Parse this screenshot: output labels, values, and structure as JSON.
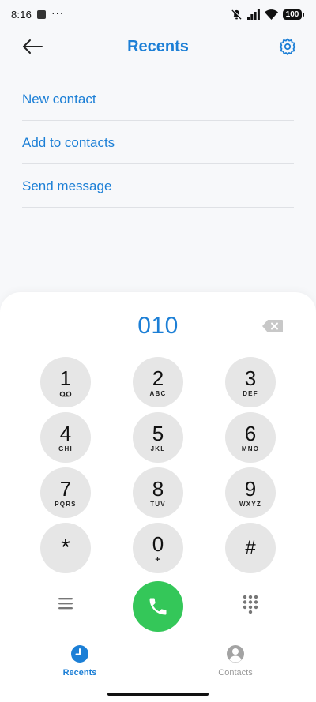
{
  "status_bar": {
    "time": "8:16",
    "dots": "···",
    "battery": "100"
  },
  "header": {
    "title": "Recents",
    "back_icon": "arrow-left-icon",
    "settings_icon": "gear-icon"
  },
  "actions": [
    {
      "label": "New contact"
    },
    {
      "label": "Add to contacts"
    },
    {
      "label": "Send message"
    }
  ],
  "dialer": {
    "number": "010",
    "keys": [
      {
        "digit": "1",
        "letters": ""
      },
      {
        "digit": "2",
        "letters": "ABC"
      },
      {
        "digit": "3",
        "letters": "DEF"
      },
      {
        "digit": "4",
        "letters": "GHI"
      },
      {
        "digit": "5",
        "letters": "JKL"
      },
      {
        "digit": "6",
        "letters": "MNO"
      },
      {
        "digit": "7",
        "letters": "PQRS"
      },
      {
        "digit": "8",
        "letters": "TUV"
      },
      {
        "digit": "9",
        "letters": "WXYZ"
      },
      {
        "digit": "*",
        "letters": ""
      },
      {
        "digit": "0",
        "letters": "+"
      },
      {
        "digit": "#",
        "letters": ""
      }
    ]
  },
  "nav": {
    "tabs": [
      {
        "label": "Recents",
        "icon": "clock-icon",
        "active": true
      },
      {
        "label": "Contacts",
        "icon": "person-icon",
        "active": false
      }
    ]
  },
  "colors": {
    "accent": "#1c7fd6",
    "call": "#34c759",
    "key_bg": "#e6e6e6",
    "inactive": "#9a9a9a"
  }
}
